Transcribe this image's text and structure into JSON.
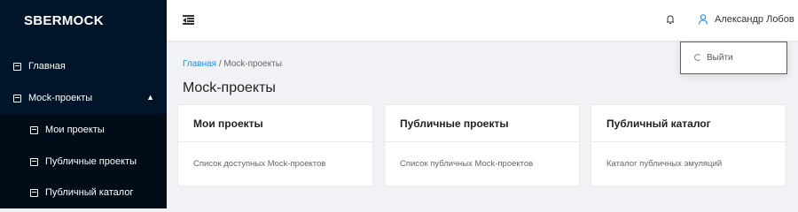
{
  "sidebar": {
    "logo": "SBERMOCK",
    "items": [
      {
        "label": "Главная"
      },
      {
        "label": "Mock-проекты"
      }
    ],
    "subitems": [
      {
        "label": "Мои проекты"
      },
      {
        "label": "Публичные проекты"
      },
      {
        "label": "Публичный каталог"
      }
    ]
  },
  "header": {
    "user_name": "Александр Лобов"
  },
  "dropdown": {
    "logout_label": "Выйти"
  },
  "breadcrumb": {
    "home": "Главная",
    "separator": " / ",
    "current": "Mock-проекты"
  },
  "page": {
    "title": "Mock-проекты"
  },
  "cards": [
    {
      "title": "Мои проекты",
      "description": "Список доступных Mock-проектов"
    },
    {
      "title": "Публичные проекты",
      "description": "Список публичных Mock-проектов"
    },
    {
      "title": "Публичный каталог",
      "description": "Каталог публичных эмуляций"
    }
  ],
  "colors": {
    "sidebar": "#001529",
    "submenu": "#000c17",
    "link": "#1890ff",
    "user_icon": "#1890ff",
    "highlight_border": "#d32f2f"
  },
  "icons": {
    "menu_item": "layout-icon",
    "fold": "menu-fold-icon",
    "bell": "bell-icon",
    "user": "user-icon",
    "logout": "logout-icon",
    "caret": "caret-up-icon"
  }
}
